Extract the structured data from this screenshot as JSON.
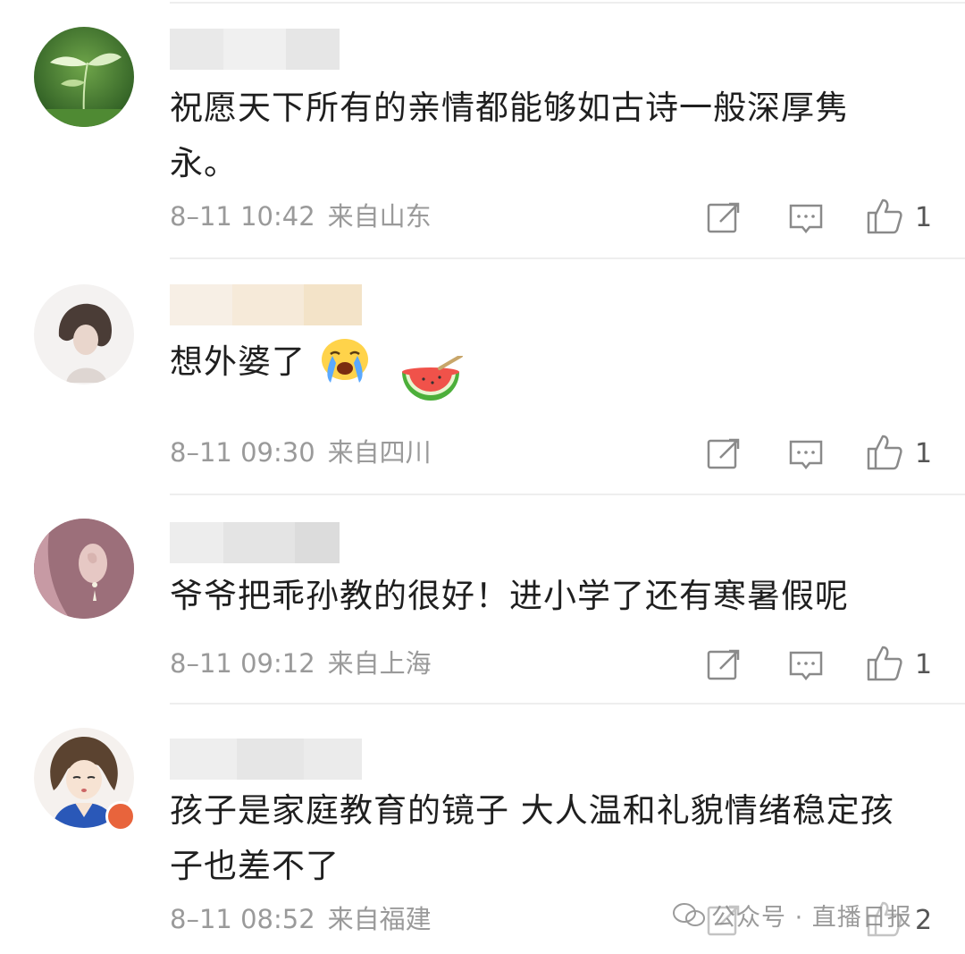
{
  "comments": [
    {
      "text": "祝愿天下所有的亲情都能够如古诗一般深厚隽永。",
      "time": "8–11 10:42",
      "location": "来自山东",
      "likes": "1",
      "avatar": "leaf-plant-avatar"
    },
    {
      "text": "想外婆了",
      "time": "8–11 09:30",
      "location": "来自四川",
      "likes": "1",
      "avatar": "girl-photo-avatar",
      "emojis": [
        "crying-face-emoji",
        "watermelon-emoji"
      ]
    },
    {
      "text": "爷爷把乖孙教的很好！进小学了还有寒暑假呢",
      "time": "8–11 09:12",
      "location": "来自上海",
      "likes": "1",
      "avatar": "pink-hair-avatar"
    },
    {
      "text": "孩子是家庭教育的镜子  大人温和礼貌情绪稳定孩子也差不了",
      "time": "8–11 08:52",
      "location": "来自福建",
      "likes": "2",
      "avatar": "cartoon-girl-avatar"
    }
  ],
  "watermark": "公众号 · 直播日报",
  "colors": {
    "meta": "#9a9a9a",
    "divider": "#eeeeee",
    "text": "#1f1f1f",
    "icon": "#8a8a8a"
  }
}
